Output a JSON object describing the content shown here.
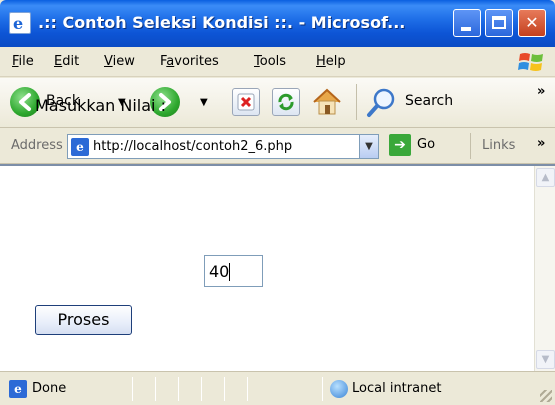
{
  "window": {
    "title": ".:: Contoh Seleksi Kondisi ::. - Microsof...",
    "title_icon": "ie-page-icon",
    "controls": [
      "minimize",
      "maximize",
      "close"
    ]
  },
  "menubar": {
    "items": [
      {
        "label": "File",
        "u": "F",
        "rest": "ile"
      },
      {
        "label": "Edit",
        "u": "E",
        "rest": "dit"
      },
      {
        "label": "View",
        "u": "V",
        "rest": "iew"
      },
      {
        "label": "Favorites",
        "pre": "F",
        "u": "a",
        "rest": "vorites"
      },
      {
        "label": "Tools",
        "u": "T",
        "rest": "ools"
      },
      {
        "label": "Help",
        "u": "H",
        "rest": "elp"
      }
    ]
  },
  "toolbar": {
    "back_label": "Back",
    "search_label": "Search",
    "overflow": "»"
  },
  "address": {
    "label": "Address",
    "url": "http://localhost/contoh2_6.php",
    "go_label": "Go",
    "links_label": "Links",
    "overflow": "»"
  },
  "page": {
    "prompt": "Masukkan Nilai :",
    "input_value": "40",
    "submit_label": "Proses"
  },
  "statusbar": {
    "status": "Done",
    "zone": "Local intranet"
  },
  "colors": {
    "titlebar": "#0a4bc4",
    "chrome": "#ece9d8",
    "close": "#c4401e",
    "go_green": "#3aa83a"
  }
}
